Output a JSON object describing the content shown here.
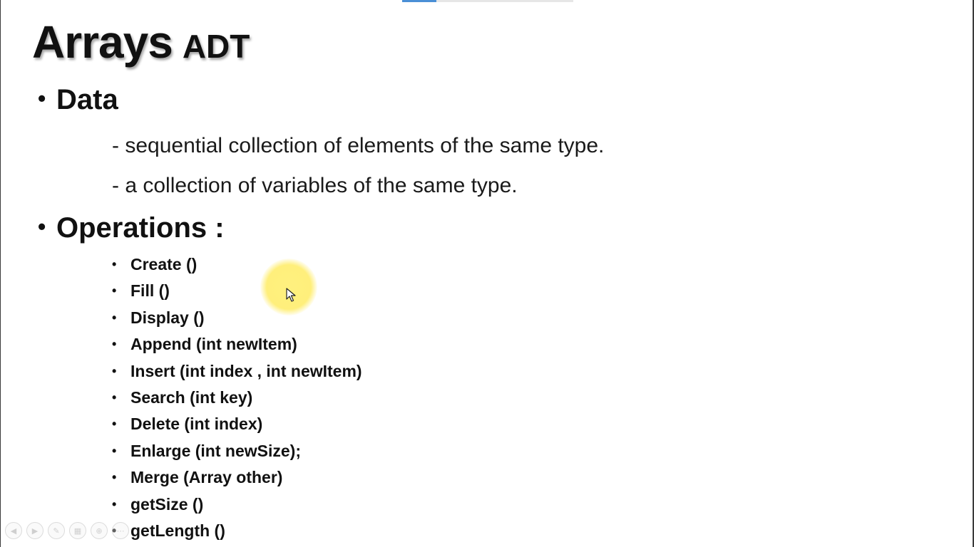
{
  "slide": {
    "title_main": "Arrays",
    "title_suffix": "ADT",
    "sections": [
      {
        "bullet": "•",
        "heading": "Data",
        "lines": [
          "- sequential collection of elements of the same type.",
          "- a collection of variables of the same type."
        ]
      },
      {
        "bullet": "•",
        "heading": "Operations :",
        "items": [
          "Create ()",
          "Fill ()",
          "Display ()",
          "Append (int newItem)",
          "Insert (int index , int newItem)",
          "Search (int key)",
          "Delete (int index)",
          "Enlarge (int newSize);",
          "Merge (Array other)",
          "getSize ()",
          "getLength ()"
        ]
      }
    ]
  },
  "presentation": {
    "pointer_highlight_color": "#fff176",
    "controls": [
      {
        "icon": "previous-slide-icon",
        "glyph": "◀"
      },
      {
        "icon": "next-slide-icon",
        "glyph": "▶"
      },
      {
        "icon": "pen-icon",
        "glyph": "✎"
      },
      {
        "icon": "slides-icon",
        "glyph": "▦"
      },
      {
        "icon": "zoom-icon",
        "glyph": "⊕"
      },
      {
        "icon": "more-icon",
        "glyph": "⋯"
      }
    ]
  },
  "colors": {
    "text": "#111111",
    "background": "#ffffff",
    "progress_fill": "#4a8fd6"
  }
}
